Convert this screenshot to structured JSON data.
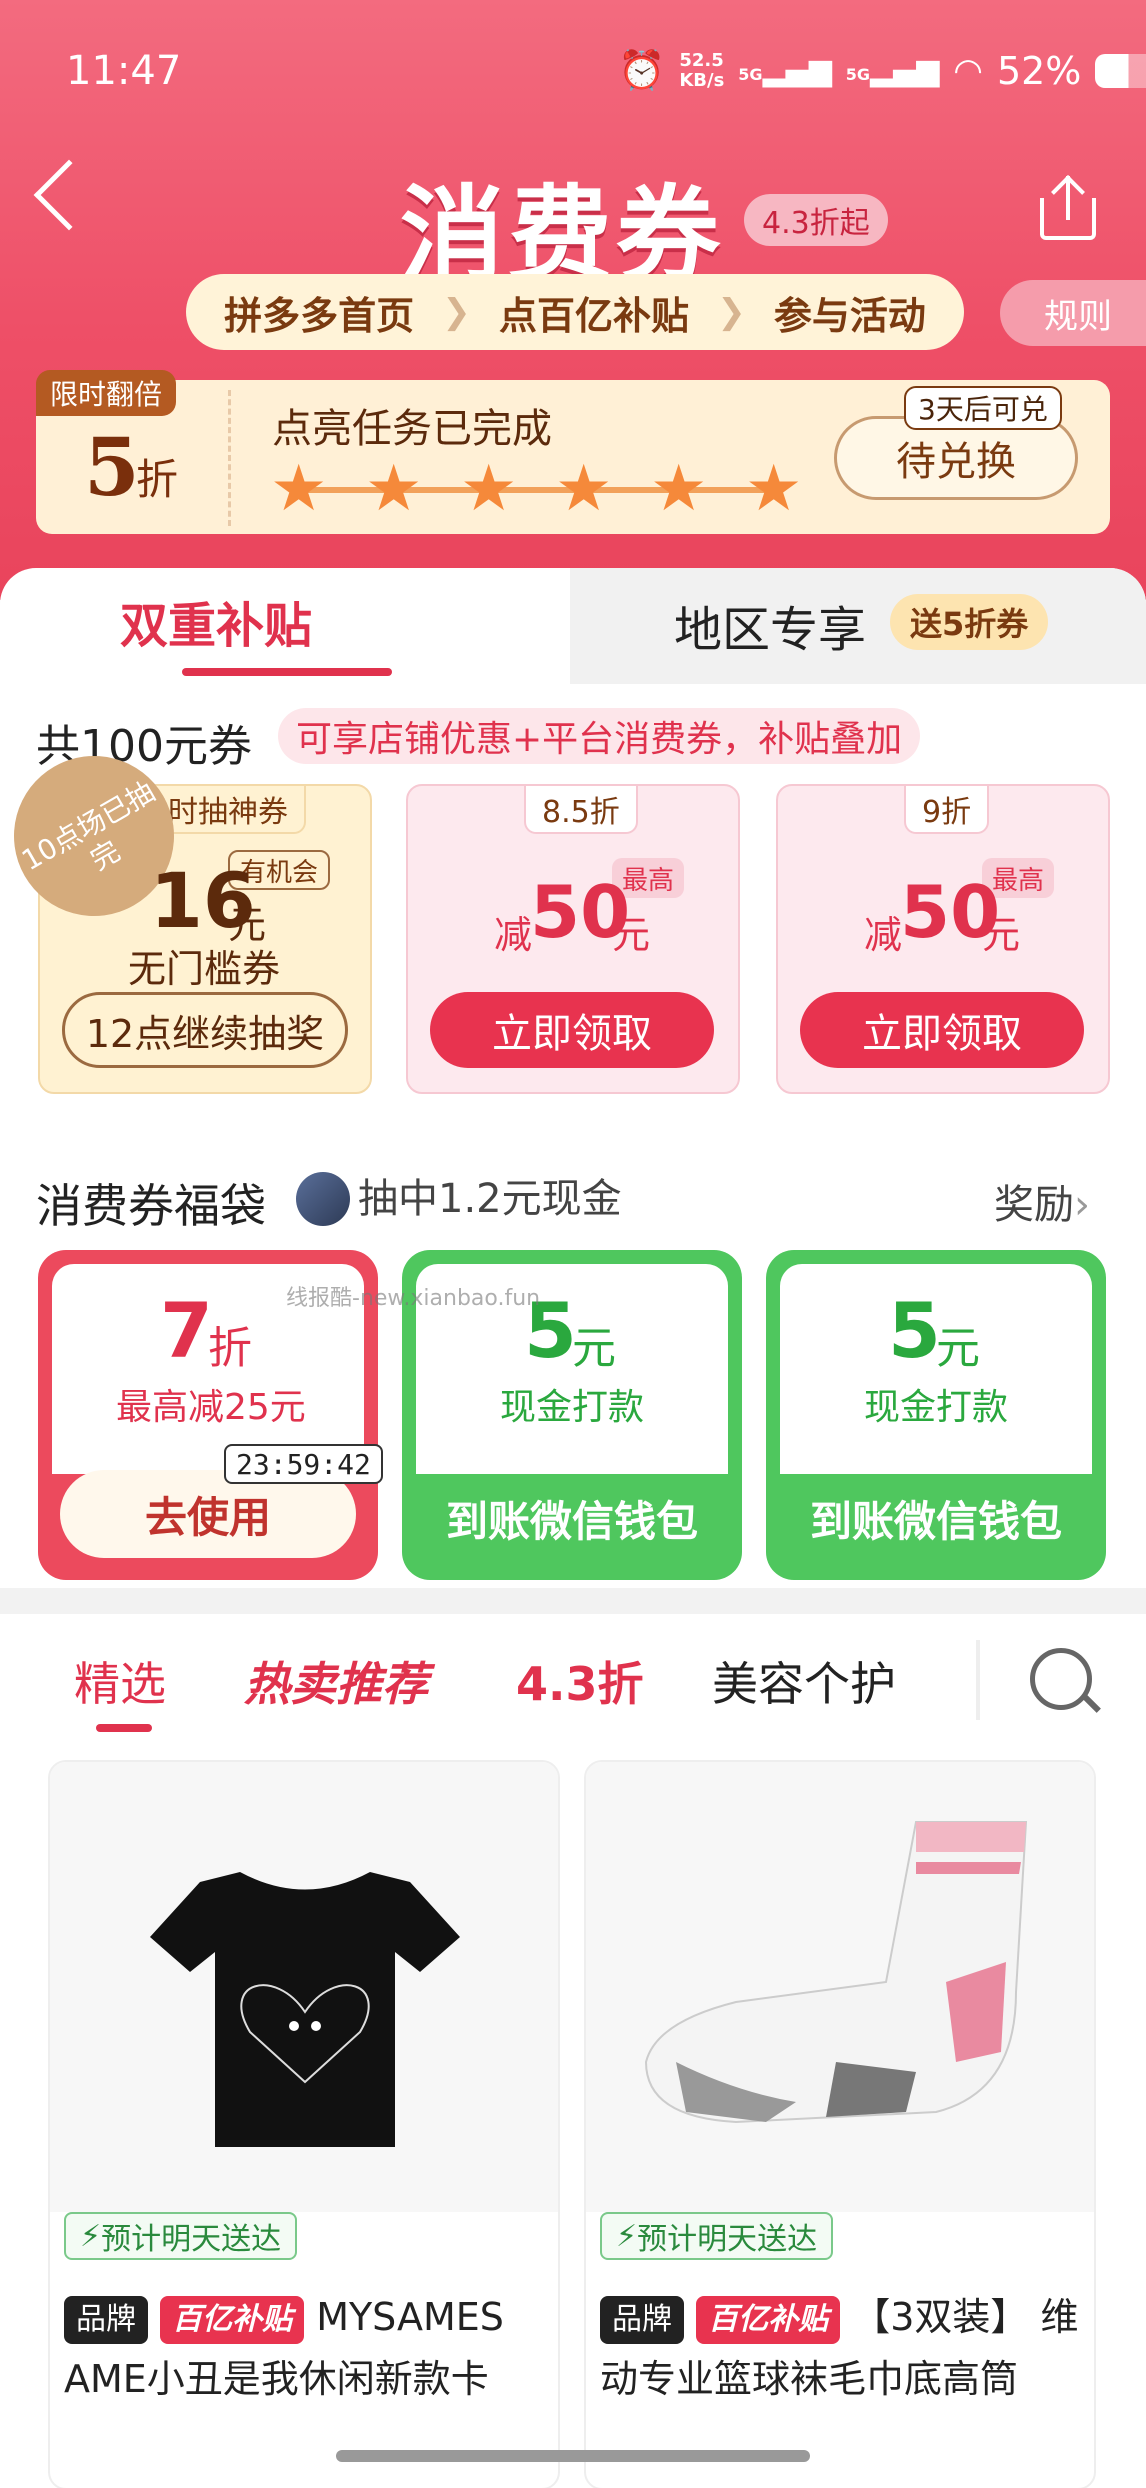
{
  "status_bar": {
    "time": "11:47",
    "speed": "52.5",
    "speed_unit": "KB/s",
    "net1": "5G",
    "net2": "5G",
    "battery": "52%"
  },
  "header": {
    "title": "消费券",
    "title_tag": "4.3折起",
    "rules": "规则",
    "steps": [
      "拼多多首页",
      "点百亿补贴",
      "参与活动"
    ]
  },
  "task": {
    "badge": "限时翻倍",
    "discount": "5",
    "discount_suffix": "折",
    "title": "点亮任务已完成",
    "stars": 6,
    "exchange_tag": "3天后可兑",
    "exchange": "待兑换"
  },
  "tabs": {
    "left": "双重补贴",
    "right": "地区专享",
    "right_badge": "送5折券"
  },
  "total": {
    "title": "共100元券",
    "pill": "可享店铺优惠+平台消费券，补贴叠加"
  },
  "coupons": [
    {
      "label": "限时抽神券",
      "badge": "10点场已抽完",
      "chance": "有机会",
      "amount": "16",
      "unit": "元",
      "desc": "无门槛券",
      "button": "12点继续抽奖"
    },
    {
      "label": "8.5折",
      "top": "最高",
      "prefix": "减",
      "amount": "50",
      "unit": "元",
      "button": "立即领取"
    },
    {
      "label": "9折",
      "top": "最高",
      "prefix": "减",
      "amount": "50",
      "unit": "元",
      "button": "立即领取"
    }
  ],
  "bag": {
    "title": "消费券福袋",
    "message": "抽中1.2元现金",
    "more": "奖励",
    "rewards": [
      {
        "big": "7",
        "unit": "折",
        "sub": "最高减25元",
        "timer": "23:59:42",
        "button": "去使用"
      },
      {
        "big": "5",
        "unit": "元",
        "sub": "现金打款",
        "button": "到账微信钱包"
      },
      {
        "big": "5",
        "unit": "元",
        "sub": "现金打款",
        "button": "到账微信钱包"
      }
    ]
  },
  "watermark": "线报酷-new.xianbao.fun",
  "product_tabs": [
    "精选",
    "热卖推荐",
    "4.3折",
    "美容个护"
  ],
  "products": [
    {
      "delivery": "预计明天送达",
      "brand": "品牌",
      "subsidy": "百亿补贴",
      "name": "MYSAMES AME小丑是我休闲新款卡"
    },
    {
      "delivery": "预计明天送达",
      "brand": "品牌",
      "subsidy": "百亿补贴",
      "name": "【3双装】 维动专业篮球袜毛巾底高筒"
    }
  ],
  "colors": {
    "brand_red": "#e0324d",
    "header_pink": "#ee4f67",
    "green": "#4fc75e",
    "gold": "#fff2d2"
  }
}
